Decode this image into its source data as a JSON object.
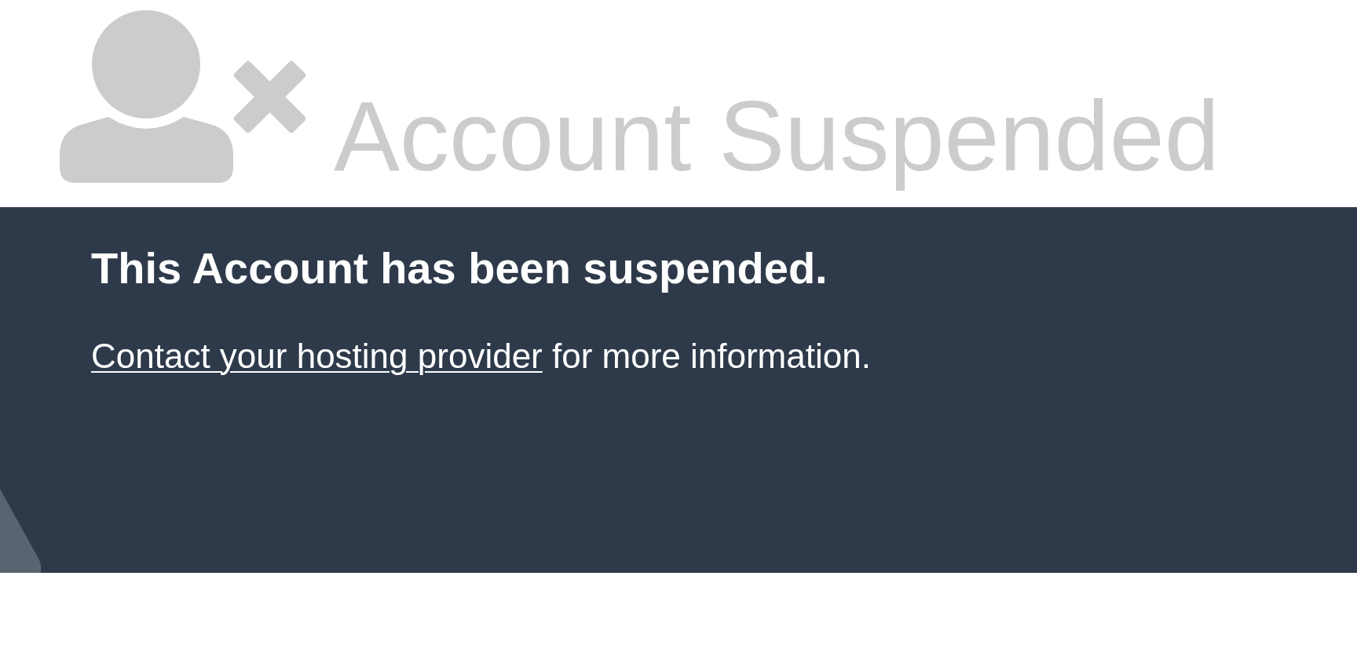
{
  "header": {
    "title": "Account Suspended"
  },
  "notice": {
    "heading": "This Account has been suspended.",
    "message": {
      "link": "Contact your hosting provider",
      "text": "for more information."
    }
  }
}
